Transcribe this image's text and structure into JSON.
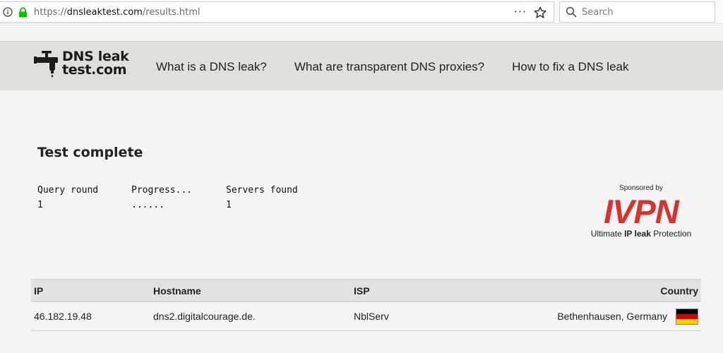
{
  "browser": {
    "url_prefix": "https://",
    "url_domain": "dnsleaktest.com",
    "url_path": "/results.html",
    "more_icon": "···",
    "search_placeholder": "Search"
  },
  "site": {
    "logo_line1": "DNS leak",
    "logo_line2": "test.com",
    "nav": [
      {
        "label": "What is a DNS leak?"
      },
      {
        "label": "What are transparent DNS proxies?"
      },
      {
        "label": "How to fix a DNS leak"
      }
    ]
  },
  "main": {
    "title": "Test complete",
    "stats": [
      {
        "label": "Query round",
        "value": "1"
      },
      {
        "label": "Progress...",
        "value": "......"
      },
      {
        "label": "Servers found",
        "value": "1"
      }
    ]
  },
  "sponsor": {
    "label": "Sponsored by",
    "brand": "IVPN",
    "tag_prefix": "Ultimate ",
    "tag_bold": "IP leak",
    "tag_suffix": " Protection",
    "brand_color": "#d8322d"
  },
  "results": {
    "headers": {
      "ip": "IP",
      "hostname": "Hostname",
      "isp": "ISP",
      "country": "Country"
    },
    "rows": [
      {
        "ip": "46.182.19.48",
        "hostname": "dns2.digitalcourage.de.",
        "isp": "NblServ",
        "country": "Bethenhausen, Germany",
        "flag": "germany-flag"
      }
    ]
  }
}
